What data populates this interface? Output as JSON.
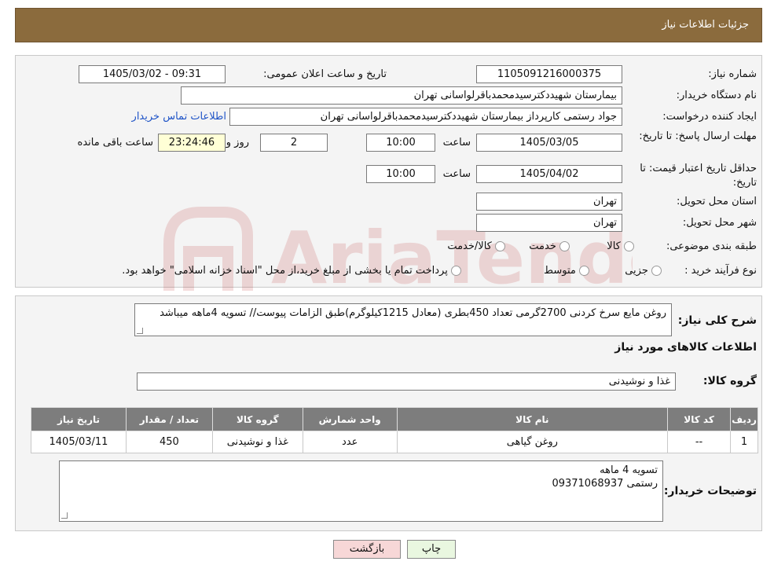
{
  "header": {
    "title": "جزئیات اطلاعات نیاز"
  },
  "need_number": {
    "label": "شماره نیاز:",
    "value": "1105091216000375"
  },
  "announce_datetime": {
    "label": "تاریخ و ساعت اعلان عمومی:",
    "value": "1405/03/02 - 09:31"
  },
  "buyer_org": {
    "label": "نام دستگاه خریدار:",
    "value": "بیمارستان شهیددکترسیدمحمدباقرلواسانی تهران"
  },
  "requester": {
    "label": "ایجاد کننده درخواست:",
    "value": "جواد رستمی کارپرداز بیمارستان شهیددکترسیدمحمدباقرلواسانی تهران",
    "contact_link": "اطلاعات تماس خریدار"
  },
  "reply_deadline": {
    "label": "مهلت ارسال پاسخ: تا تاریخ:",
    "date": "1405/03/05",
    "time_label": "ساعت",
    "time": "10:00",
    "days": "2",
    "days_label": "روز و",
    "remaining": "23:24:46",
    "remaining_label": "ساعت باقی مانده"
  },
  "price_validity": {
    "label": "حداقل تاریخ اعتبار قیمت: تا تاریخ:",
    "date": "1405/04/02",
    "time_label": "ساعت",
    "time": "10:00"
  },
  "delivery_province": {
    "label": "استان محل تحویل:",
    "value": "تهران"
  },
  "delivery_city": {
    "label": "شهر محل تحویل:",
    "value": "تهران"
  },
  "category": {
    "label": "طبقه بندی موضوعی:",
    "options": [
      "کالا",
      "خدمت",
      "کالا/خدمت"
    ]
  },
  "purchase_process": {
    "label": "نوع فرآیند خرید :",
    "options": [
      "جزیی",
      "متوسط"
    ],
    "note": "پرداخت تمام یا بخشی از مبلغ خرید،از محل \"اسناد خزانه اسلامی\" خواهد بود."
  },
  "watermark_text": "AriaTender.neT",
  "description": {
    "label": "شرح کلی نیاز:",
    "value": "روغن مایع سرخ کردنی 2700گرمی تعداد 450بطری (معادل 1215کیلوگرم)طبق الزامات پیوست// تسویه 4ماهه میباشد"
  },
  "items_section_title": "اطلاعات کالاهای مورد نیاز",
  "goods_group": {
    "label": "گروه کالا:",
    "value": "غذا و نوشیدنی"
  },
  "table": {
    "headers": [
      "ردیف",
      "کد کالا",
      "نام کالا",
      "واحد شمارش",
      "گروه کالا",
      "تعداد / مقدار",
      "تاریخ نیاز"
    ],
    "rows": [
      [
        "1",
        "--",
        "روغن گیاهی",
        "عدد",
        "غذا و نوشیدنی",
        "450",
        "1405/03/11"
      ]
    ]
  },
  "buyer_notes": {
    "label": "توضیحات خریدار:",
    "line1": "تسویه 4 ماهه",
    "line2": "رستمی 09371068937"
  },
  "buttons": {
    "print": "چاپ",
    "back": "بازگشت"
  }
}
